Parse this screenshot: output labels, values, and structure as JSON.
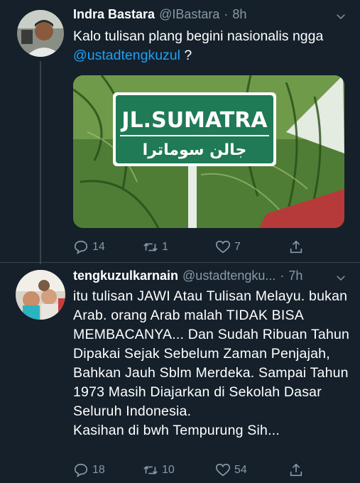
{
  "tweets": [
    {
      "name": "Indra Bastara",
      "handle": "@IBastara",
      "separator": "·",
      "time": "8h",
      "text_before": "Kalo tulisan plang begini nasionalis ngga ",
      "mention": "@ustadtengkuzul",
      "text_after": " ?",
      "media": {
        "sign_line1": "JL.SUMATRA",
        "sign_line2": "جالن سوماترا"
      },
      "replies": "14",
      "retweets": "1",
      "likes": "7"
    },
    {
      "name": "tengkuzulkarnain",
      "handle": "@ustadtengku...",
      "separator": "·",
      "time": "7h",
      "text": "itu tulisan JAWI Atau Tulisan Melayu. bukan Arab. orang Arab malah TIDAK BISA MEMBACANYA... Dan Sudah Ribuan Tahun Dipakai Sejak Sebelum Zaman Penjajah, Bahkan Jauh Sblm Merdeka. Sampai Tahun 1973 Masih Diajarkan di Sekolah Dasar Seluruh Indonesia.",
      "text_line2": "Kasihan di bwh Tempurung Sih...",
      "replies": "18",
      "retweets": "10",
      "likes": "54"
    }
  ],
  "colors": {
    "background": "#15202b",
    "secondary_text": "#8899a6",
    "link": "#1da1f2",
    "divider": "#38444d"
  },
  "icons": [
    "reply-icon",
    "retweet-icon",
    "like-icon",
    "share-icon",
    "chevron-down-icon"
  ]
}
